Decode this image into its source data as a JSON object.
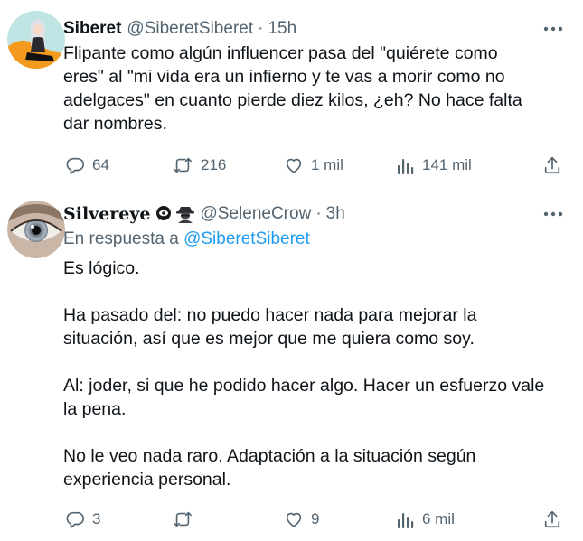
{
  "tweets": [
    {
      "author": {
        "name": "Siberet",
        "handle": "@SiberetSiberet"
      },
      "separator": "·",
      "time": "15h",
      "lines": [
        "Flipante como algún influencer pasa del \"quiérete como",
        "eres\" al \"mi vida era un infierno y te vas a morir como no",
        "adelgaces\" en cuanto pierde diez kilos, ¿eh? No hace falta",
        "dar nombres."
      ],
      "stats": {
        "replies": "64",
        "retweets": "216",
        "likes": "1 mil",
        "views": "141 mil"
      }
    },
    {
      "author": {
        "name": "Silvereye",
        "handle": "@SeleneCrow",
        "badge_icons": [
          "eye-in-speech-bubble-icon",
          "detective-icon"
        ]
      },
      "separator": "·",
      "time": "3h",
      "reply_to": {
        "prefix": "En respuesta a",
        "mention": "@SiberetSiberet"
      },
      "paragraphs": [
        [
          "Es lógico."
        ],
        [
          "Ha pasado del: no puedo hacer nada para mejorar la",
          "situación, así que es mejor que me quiera como soy."
        ],
        [
          "Al: joder, si que he podido hacer algo. Hacer un esfuerzo vale",
          "la pena."
        ],
        [
          "No le veo nada raro. Adaptación a la situación según",
          "experiencia personal."
        ]
      ],
      "stats": {
        "replies": "3",
        "retweets": "",
        "likes": "9",
        "views": "6 mil"
      }
    }
  ],
  "colors": {
    "text_primary": "#0f1419",
    "text_secondary": "#536471",
    "link": "#1d9bf0",
    "divider": "#eff3f4",
    "background": "#ffffff"
  },
  "icons": {
    "reply": "speech-bubble-icon",
    "retweet": "retweet-arrows-icon",
    "like": "heart-icon",
    "views": "bar-chart-icon",
    "share": "share-upload-icon",
    "more": "more-dots-icon"
  }
}
